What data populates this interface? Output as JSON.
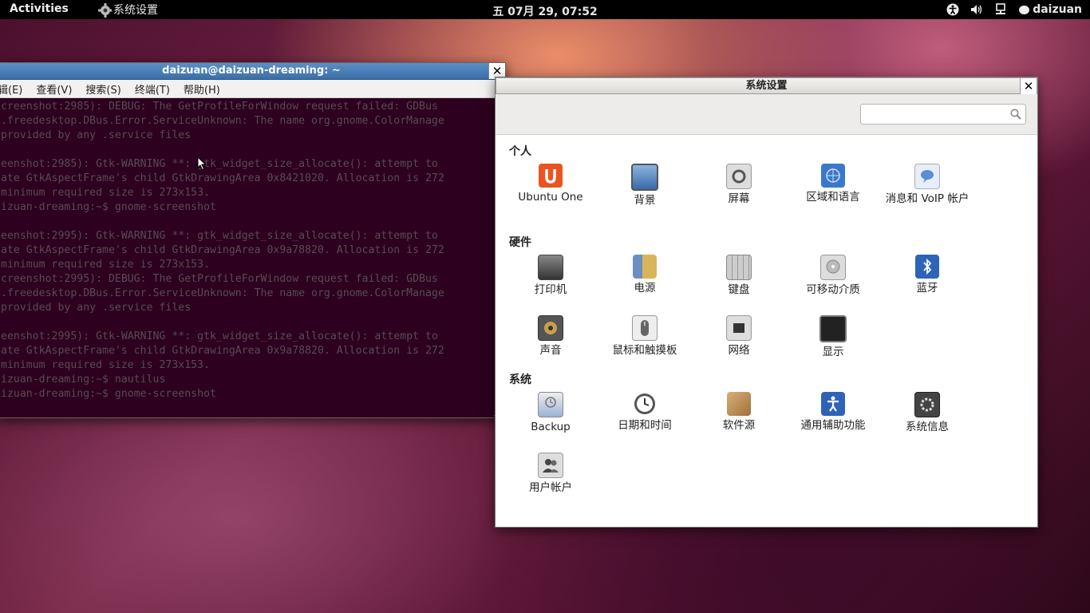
{
  "top_panel": {
    "activities": "Activities",
    "app_name": "系统设置",
    "clock": "五 07月 29, 07:52",
    "user": "daizuan"
  },
  "terminal": {
    "title": "daizuan@daizuan-dreaming: ~",
    "menu": [
      "辑(E)",
      "查看(V)",
      "搜索(S)",
      "终端(T)",
      "帮助(H)"
    ],
    "lines": [
      "creenshot:2985): DEBUG: The GetProfileForWindow request failed: GDBus",
      ".freedesktop.DBus.Error.ServiceUnknown: The name org.gnome.ColorManage",
      "provided by any .service files",
      "",
      "eenshot:2985): Gtk-WARNING **: gtk_widget_size_allocate(): attempt to",
      "ate GtkAspectFrame's child GtkDrawingArea 0x8421020. Allocation is 272",
      "minimum required size is 273x153.",
      "izuan-dreaming:~$ gnome-screenshot",
      "",
      "eenshot:2995): Gtk-WARNING **: gtk_widget_size_allocate(): attempt to",
      "ate GtkAspectFrame's child GtkDrawingArea 0x9a78820. Allocation is 272",
      "minimum required size is 273x153.",
      "creenshot:2995): DEBUG: The GetProfileForWindow request failed: GDBus",
      ".freedesktop.DBus.Error.ServiceUnknown: The name org.gnome.ColorManage",
      "provided by any .service files",
      "",
      "eenshot:2995): Gtk-WARNING **: gtk_widget_size_allocate(): attempt to",
      "ate GtkAspectFrame's child GtkDrawingArea 0x9a78820. Allocation is 272",
      "minimum required size is 273x153.",
      "izuan-dreaming:~$ nautilus",
      "izuan-dreaming:~$ gnome-screenshot"
    ]
  },
  "settings": {
    "title": "系统设置",
    "search_placeholder": "",
    "sections": {
      "personal": {
        "title": "个人",
        "items": [
          {
            "label": "Ubuntu One",
            "icon": "ubuntu-one-icon",
            "color": "#e95420"
          },
          {
            "label": "背景",
            "icon": "background-icon",
            "color": "#4a78b0"
          },
          {
            "label": "屏幕",
            "icon": "screen-icon",
            "color": "#777777"
          },
          {
            "label": "区域和语言",
            "icon": "region-language-icon",
            "color": "#3b78c8"
          },
          {
            "label": "消息和 VoIP 帐户",
            "icon": "messaging-icon",
            "color": "#5a8ed6"
          }
        ]
      },
      "hardware": {
        "title": "硬件",
        "items": [
          {
            "label": "打印机",
            "icon": "printer-icon",
            "color": "#555555"
          },
          {
            "label": "电源",
            "icon": "power-icon",
            "color": "#6a8fc0"
          },
          {
            "label": "键盘",
            "icon": "keyboard-icon",
            "color": "#9a9a9a"
          },
          {
            "label": "可移动介质",
            "icon": "removable-media-icon",
            "color": "#b0b0b0"
          },
          {
            "label": "蓝牙",
            "icon": "bluetooth-icon",
            "color": "#2f63b8"
          },
          {
            "label": "声音",
            "icon": "sound-icon",
            "color": "#8a7a5a"
          },
          {
            "label": "鼠标和触摸板",
            "icon": "mouse-icon",
            "color": "#888888"
          },
          {
            "label": "网络",
            "icon": "network-icon",
            "color": "#555555"
          },
          {
            "label": "显示",
            "icon": "display-icon",
            "color": "#222222"
          }
        ]
      },
      "system": {
        "title": "系统",
        "items": [
          {
            "label": "Backup",
            "icon": "backup-icon",
            "color": "#8fa8c8"
          },
          {
            "label": "日期和时间",
            "icon": "clock-icon",
            "color": "#555555"
          },
          {
            "label": "软件源",
            "icon": "software-sources-icon",
            "color": "#b8905a"
          },
          {
            "label": "通用辅助功能",
            "icon": "accessibility-icon",
            "color": "#2f63b8"
          },
          {
            "label": "系统信息",
            "icon": "system-info-icon",
            "color": "#444444"
          },
          {
            "label": "用户帐户",
            "icon": "user-accounts-icon",
            "color": "#555555"
          }
        ]
      }
    }
  }
}
